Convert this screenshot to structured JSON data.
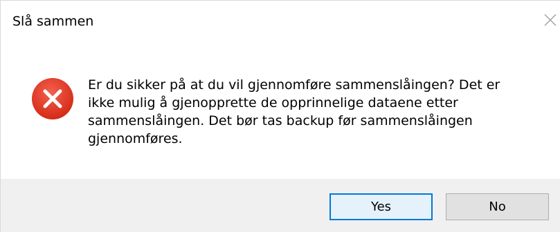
{
  "window": {
    "title": "Slå sammen",
    "close_icon": "close-icon"
  },
  "content": {
    "icon": "error-icon",
    "message": "Er du sikker på at du vil gjennomføre sammenslåingen? Det er\nikke mulig å gjenopprette de opprinnelige dataene etter\nsammenslåingen. Det bør tas backup før sammenslåingen\ngjennomføres."
  },
  "buttons": {
    "yes_label": "Yes",
    "no_label": "No"
  },
  "colors": {
    "error_red": "#e81123",
    "accent": "#0078d7",
    "footer_bg": "#f0f0f0"
  }
}
